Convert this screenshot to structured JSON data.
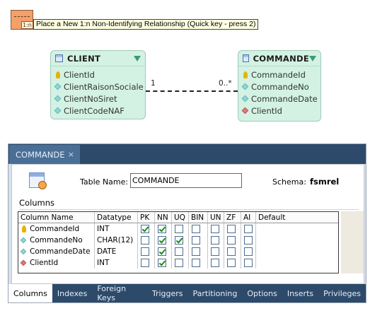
{
  "toolbar": {
    "relationship_button_label": "1:n",
    "tooltip": "Place a New 1:n Non-Identifying Relationship (Quick key - press 2)"
  },
  "diagram": {
    "client": {
      "title": "CLIENT",
      "columns": [
        {
          "name": "ClientId",
          "kind": "key"
        },
        {
          "name": "ClientRaisonSociale",
          "kind": "attribute"
        },
        {
          "name": "ClientNoSiret",
          "kind": "attribute"
        },
        {
          "name": "ClientCodeNAF",
          "kind": "attribute"
        }
      ]
    },
    "commande": {
      "title": "COMMANDE",
      "columns": [
        {
          "name": "CommandeId",
          "kind": "key"
        },
        {
          "name": "CommandeNo",
          "kind": "attribute"
        },
        {
          "name": "CommandeDate",
          "kind": "attribute"
        },
        {
          "name": "ClientId",
          "kind": "foreign-key"
        }
      ]
    },
    "relationship": {
      "left_cardinality": "1",
      "right_cardinality": "0..*"
    }
  },
  "editor": {
    "tab_title": "COMMANDE",
    "close_glyph": "×",
    "table_name_label": "Table Name:",
    "table_name_value": "COMMANDE",
    "schema_label": "Schema:",
    "schema_value": "fsmrel",
    "columns_section_label": "Columns",
    "grid": {
      "headers": [
        "Column Name",
        "Datatype",
        "PK",
        "NN",
        "UQ",
        "BIN",
        "UN",
        "ZF",
        "AI",
        "Default"
      ],
      "rows": [
        {
          "name": "CommandeId",
          "kind": "key",
          "datatype": "INT",
          "flags": [
            true,
            true,
            false,
            false,
            false,
            false,
            false
          ]
        },
        {
          "name": "CommandeNo",
          "kind": "attribute",
          "datatype": "CHAR(12)",
          "flags": [
            false,
            true,
            true,
            false,
            false,
            false,
            false
          ]
        },
        {
          "name": "CommandeDate",
          "kind": "attribute",
          "datatype": "DATE",
          "flags": [
            false,
            true,
            false,
            false,
            false,
            false,
            false
          ]
        },
        {
          "name": "ClientId",
          "kind": "foreign-key",
          "datatype": "INT",
          "flags": [
            false,
            true,
            false,
            false,
            false,
            false,
            false
          ]
        }
      ]
    },
    "bottom_tabs": [
      "Columns",
      "Indexes",
      "Foreign Keys",
      "Triggers",
      "Partitioning",
      "Options",
      "Inserts",
      "Privileges"
    ],
    "active_bottom_tab": "Columns"
  },
  "colors": {
    "entity_bg": "#d3f2e4",
    "tab_bar": "#2d4a6b",
    "key_icon": "#e6b400",
    "attribute_icon": "#8fd6d6",
    "foreign_key_icon": "#d87c7c",
    "check": "#1a8a1a"
  }
}
